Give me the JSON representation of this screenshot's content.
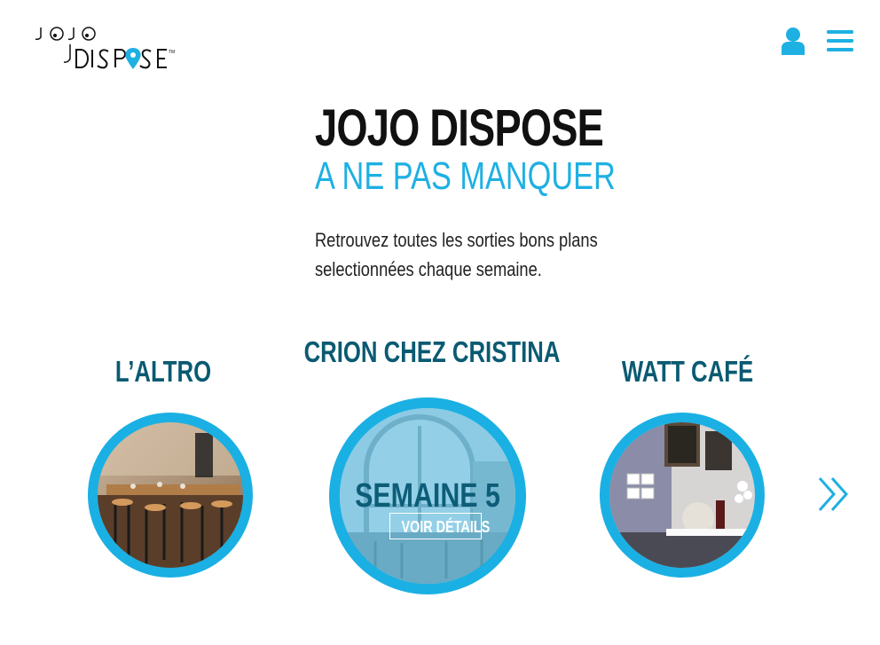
{
  "header": {
    "logo_top": "JOJO",
    "logo_bottom": "DISPOSE",
    "logo_tm": "™",
    "user_icon": "user-icon",
    "menu_icon": "hamburger-menu-icon"
  },
  "hero": {
    "title": "JOJO DISPOSE",
    "subtitle": "A NE PAS MANQUER",
    "description": "Retrouvez toutes les sorties bons plans selectionnées chaque semaine."
  },
  "cards": [
    {
      "title": "L’ALTRO"
    },
    {
      "title": "CRION CHEZ CRISTINA",
      "week_label": "SEMAINE 5",
      "button_label": "VOIR DÉTAILS"
    },
    {
      "title": "WATT CAFÉ"
    }
  ],
  "colors": {
    "accent": "#1eb0e2",
    "title_dark": "#0a5a72"
  },
  "carousel": {
    "next_icon": "double-chevron-right-icon"
  }
}
